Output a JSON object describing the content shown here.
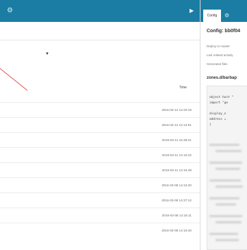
{
  "topbar": {
    "gear_icon": "gear-icon",
    "collapse_icon": "collapse-arrow-icon",
    "color": "#1b7da4"
  },
  "table": {
    "column_header": "Time",
    "rows": [
      "2016-03-12 12:20:19",
      "2016-03-12 12:13:01",
      "2016-03-11 15:38:21",
      "2016-03-11 12:15:22",
      "2016-03-11 12:16:48",
      "2016-03-08 14:44:20",
      "2016-03-08 14:37:12",
      "2016-03-08 14:16:11",
      "2016-03-08 14:15:40"
    ]
  },
  "sidebar": {
    "tab_label": "Config",
    "title": "Config: bb0f04",
    "lines": [
      "Deploy to master",
      "Last related activity",
      "Generated files"
    ],
    "section_title": "zones.d/barbap",
    "code": [
      "object host \"",
      "  import \"ge",
      "",
      "  display_n",
      "  address =",
      "}"
    ]
  }
}
